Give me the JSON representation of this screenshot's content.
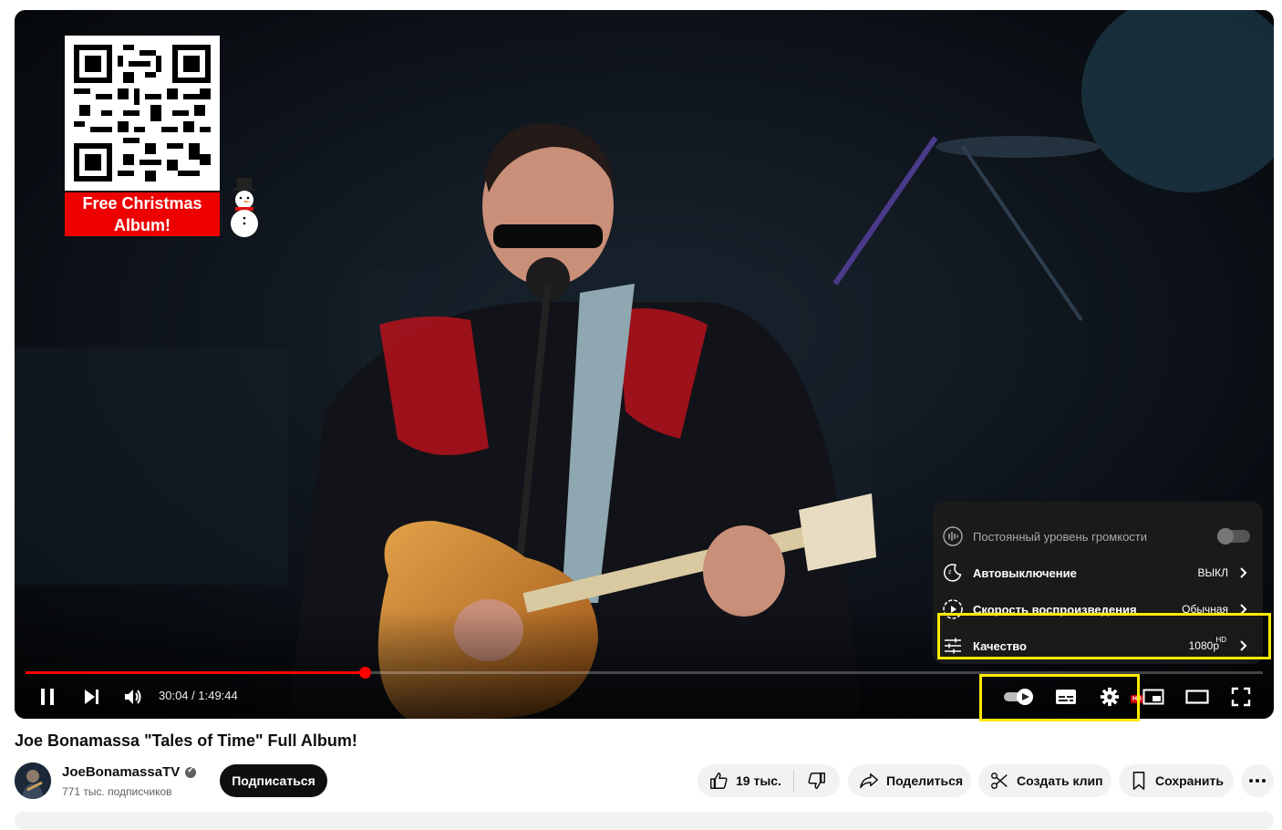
{
  "overlay": {
    "promo_text": "Free Christmas Album!"
  },
  "player": {
    "current_time": "30:04",
    "duration": "1:49:44",
    "time_display": "30:04 / 1:49:44",
    "progress_fraction": 0.274,
    "accent_color": "#ff0000",
    "hd_badge": "HD"
  },
  "settings_menu": {
    "items": [
      {
        "label": "Постоянный уровень громкости",
        "value": "",
        "icon": "stable-volume-icon",
        "toggle": true,
        "enabled": false
      },
      {
        "label": "Автовыключение",
        "value": "ВЫКЛ",
        "icon": "sleep-timer-icon"
      },
      {
        "label": "Скорость воспроизведения",
        "value": "Обычная",
        "icon": "playback-speed-icon"
      },
      {
        "label": "Качество",
        "value": "1080p",
        "value_sup": "HD",
        "icon": "quality-sliders-icon"
      }
    ]
  },
  "highlight_color": "#ffeb00",
  "video": {
    "title": "Joe Bonamassa \"Tales of Time\" Full Album!"
  },
  "channel": {
    "name": "JoeBonamassaTV",
    "subscribers": "771 тыс. подписчиков",
    "subscribe_label": "Подписаться"
  },
  "actions": {
    "likes": "19 тыс.",
    "share": "Поделиться",
    "clip": "Создать клип",
    "save": "Сохранить"
  }
}
